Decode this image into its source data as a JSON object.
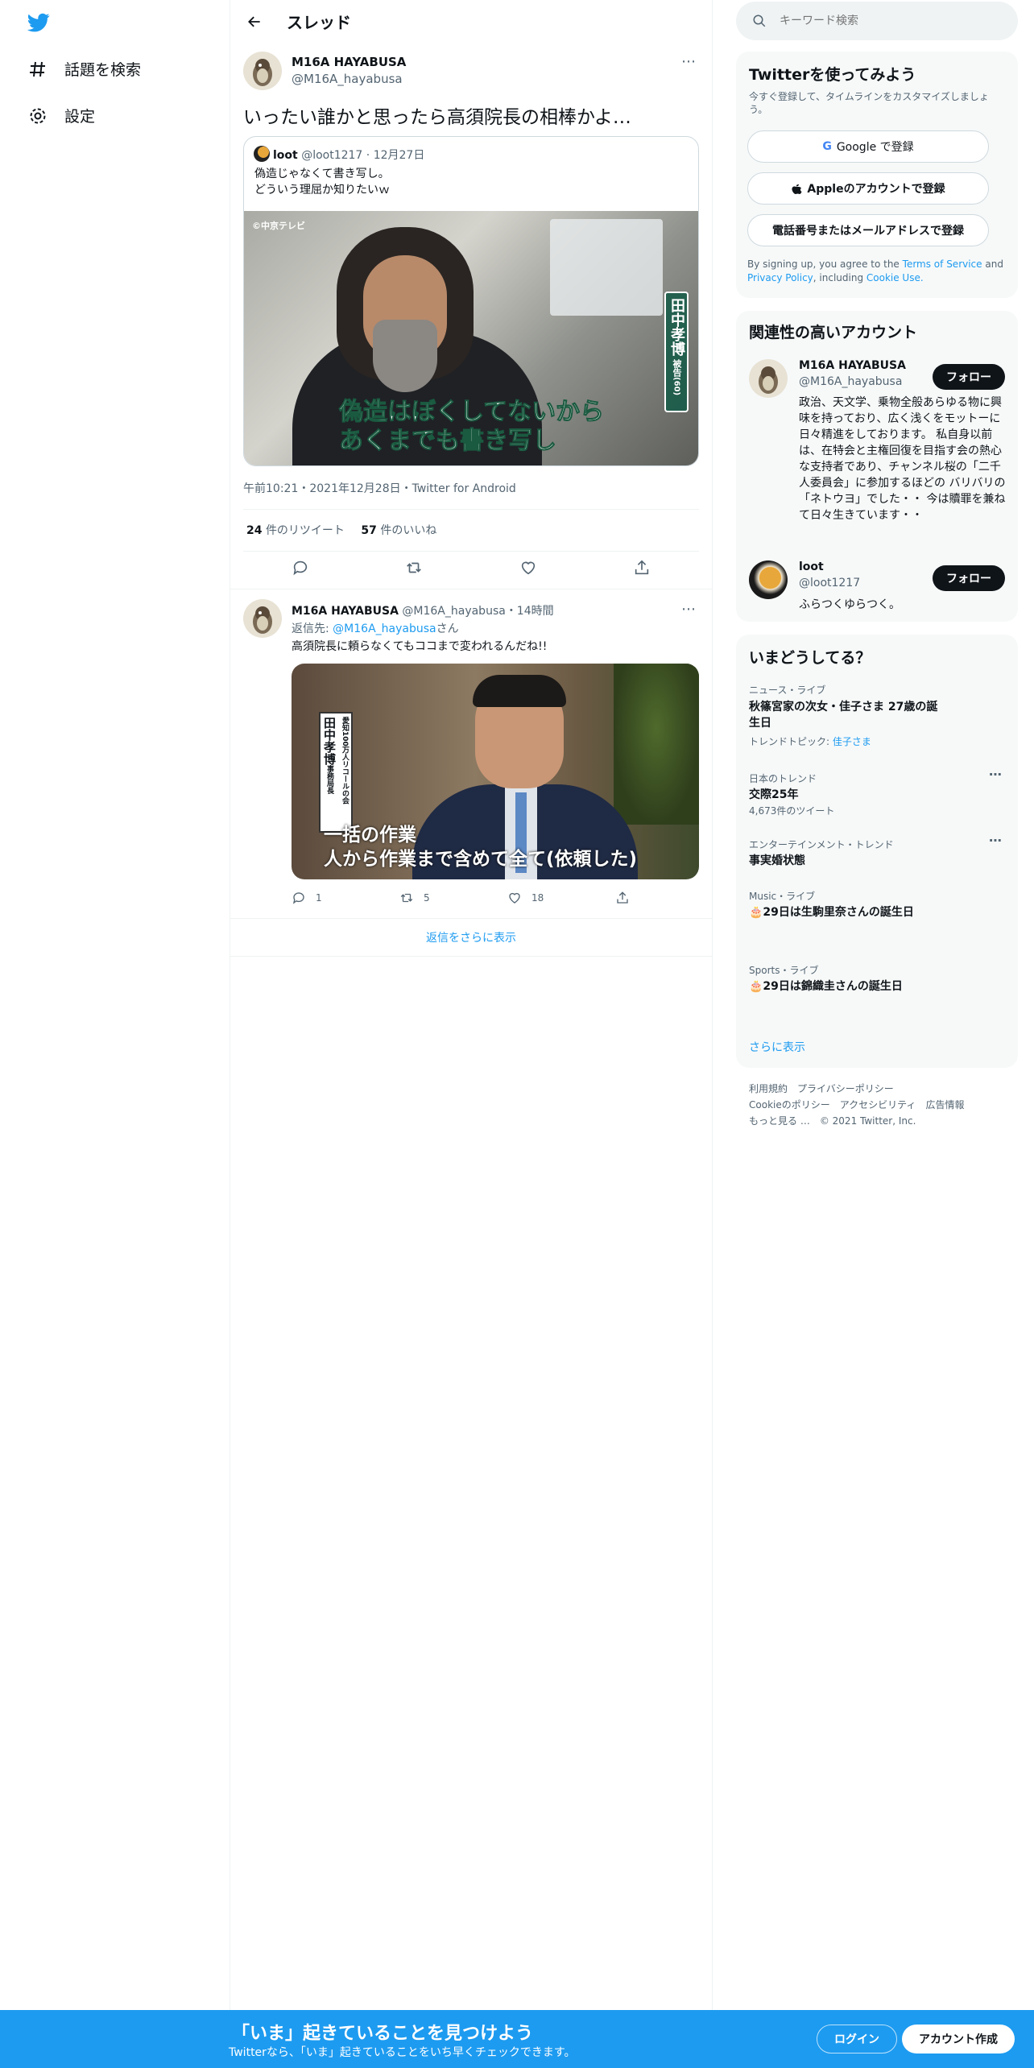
{
  "nav": {
    "explore": "話題を検索",
    "settings": "設定"
  },
  "header": {
    "title": "スレッド"
  },
  "tweet": {
    "name": "M16A HAYABUSA",
    "handle": "@M16A_hayabusa",
    "text": "いったい誰かと思ったら高須院長の相棒かよ…",
    "quote": {
      "name": "loot",
      "handle": "@loot1217",
      "date": "12月27日",
      "line1": "偽造じゃなくて書き写し。",
      "line2": "どういう理屈か知りたいｗ",
      "image": {
        "watermark": "©中京テレビ",
        "caption1": "偽造はぼくしてないから",
        "caption2": "あくまでも書き写し",
        "name_tag": "田中孝博",
        "tag_sub": "被告",
        "tag_age": "(60)"
      }
    },
    "meta": "午前10:21・2021年12月28日・Twitter for Android",
    "retweets": "24",
    "retweets_label": "件のリツイート",
    "likes": "57",
    "likes_label": "件のいいね"
  },
  "reply": {
    "name": "M16A HAYABUSA",
    "handle": "@M16A_hayabusa",
    "time": "・14時間",
    "reply_to_label": "返信先:",
    "reply_to": "@M16A_hayabusa",
    "reply_to_suffix": "さん",
    "text": "高須院長に頼らなくてもココまで変われるんだね!!",
    "image": {
      "tag_org": "愛知100万人リコールの会",
      "tag_name": "田中孝博",
      "tag_role": "事務局長",
      "caption1": "一括の作業",
      "caption2": "人から作業まで含めて全て(依頼した)"
    },
    "replies": "1",
    "retweets": "5",
    "likes": "18"
  },
  "more_replies": "返信をさらに表示",
  "search": {
    "placeholder": "キーワード検索"
  },
  "signup": {
    "title": "Twitterを使ってみよう",
    "sub": "今すぐ登録して、タイムラインをカスタマイズしましょう。",
    "google": "Google で登録",
    "apple": "Appleのアカウントで登録",
    "phone": "電話番号またはメールアドレスで登録",
    "legal1": "By signing up, you agree to the",
    "tos": "Terms of Service",
    "and": "and",
    "privacy": "Privacy Policy",
    "including": ", including",
    "cookie": "Cookie Use."
  },
  "related": {
    "title": "関連性の高いアカウント",
    "follow": "フォロー",
    "accounts": [
      {
        "name": "M16A HAYABUSA",
        "handle": "@M16A_hayabusa",
        "bio": "政治、天文学、乗物全般あらゆる物に興味を持っており、広く浅くをモットーに日々精進をしております。 私自身以前は、在特会と主権回復を目指す会の熱心な支持者であり、チャンネル桜の「二千人委員会」に参加するほどの バリバリの「ネトウヨ」でした・・ 今は贖罪を兼ねて日々生きています・・"
      },
      {
        "name": "loot",
        "handle": "@loot1217",
        "bio": "ふらつくゆらつく。"
      }
    ]
  },
  "trends": {
    "title": "いまどうしてる？",
    "items": [
      {
        "context": "ニュース・ライブ",
        "title": "秋篠宮家の次女・佳子さま 27歳の誕生日",
        "extra_label": "トレンドトピック: ",
        "extra_link": "佳子さま"
      },
      {
        "context": "日本のトレンド",
        "title": "交際25年",
        "extra": "4,673件のツイート"
      },
      {
        "context": "エンターテインメント・トレンド",
        "title": "事実婚状態"
      },
      {
        "context": "Music・ライブ",
        "title": "🎂29日は生駒里奈さんの誕生日"
      },
      {
        "context": "Sports・ライブ",
        "title": "🎂29日は錦織圭さんの誕生日"
      }
    ],
    "more": "さらに表示"
  },
  "footer": {
    "terms": "利用規約",
    "privacy": "プライバシーポリシー",
    "cookie": "Cookieのポリシー",
    "access": "アクセシビリティ",
    "ads": "広告情報",
    "more": "もっと見る …",
    "copy": "© 2021 Twitter, Inc."
  },
  "bottom": {
    "title": "「いま」起きていることを見つけよう",
    "sub": "Twitterなら、「いま」起きていることをいち早くチェックできます。",
    "login": "ログイン",
    "signup": "アカウント作成"
  },
  "colors": {
    "accent": "#1d9bf0",
    "text": "#0f1419",
    "muted": "#536471"
  }
}
